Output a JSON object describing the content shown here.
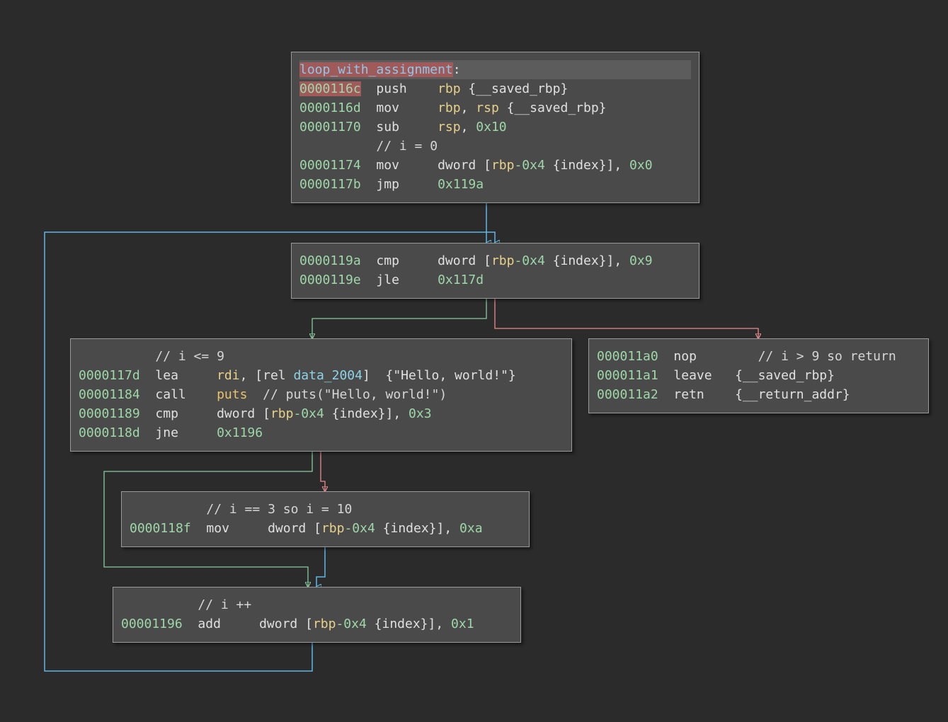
{
  "colors": {
    "background": "#2b2b2b",
    "block_bg": "#4a4a4a",
    "edge_unconditional": "#5fb8e6",
    "edge_true": "#89c9a0",
    "edge_false": "#e88c8c",
    "address": "#9ed7a8",
    "register": "#e8d28a",
    "symbol": "#8fd3e8",
    "function": "#e8c36a"
  },
  "blocks": {
    "entry": {
      "label": "loop_with_assignment",
      "label_suffix": ":",
      "lines": [
        {
          "addr": "0000116c",
          "mnemonic": "push",
          "tokens": [
            {
              "t": "reg",
              "v": "rbp"
            },
            {
              "t": "txt",
              "v": " {__saved_rbp}"
            }
          ]
        },
        {
          "addr": "0000116d",
          "mnemonic": "mov",
          "tokens": [
            {
              "t": "reg",
              "v": "rbp"
            },
            {
              "t": "txt",
              "v": ", "
            },
            {
              "t": "reg",
              "v": "rsp"
            },
            {
              "t": "txt",
              "v": " {__saved_rbp}"
            }
          ]
        },
        {
          "addr": "00001170",
          "mnemonic": "sub",
          "tokens": [
            {
              "t": "reg",
              "v": "rsp"
            },
            {
              "t": "txt",
              "v": ", "
            },
            {
              "t": "num",
              "v": "0x10"
            }
          ]
        },
        {
          "comment": "// i = 0"
        },
        {
          "addr": "00001174",
          "mnemonic": "mov",
          "tokens": [
            {
              "t": "txt",
              "v": "dword ["
            },
            {
              "t": "reg",
              "v": "rbp"
            },
            {
              "t": "num",
              "v": "-0x4"
            },
            {
              "t": "txt",
              "v": " {index}], "
            },
            {
              "t": "num",
              "v": "0x0"
            }
          ]
        },
        {
          "addr": "0000117b",
          "mnemonic": "jmp",
          "tokens": [
            {
              "t": "num",
              "v": "0x119a"
            }
          ]
        }
      ]
    },
    "cond": {
      "lines": [
        {
          "addr": "0000119a",
          "mnemonic": "cmp",
          "tokens": [
            {
              "t": "txt",
              "v": "dword ["
            },
            {
              "t": "reg",
              "v": "rbp"
            },
            {
              "t": "num",
              "v": "-0x4"
            },
            {
              "t": "txt",
              "v": " {index}], "
            },
            {
              "t": "num",
              "v": "0x9"
            }
          ]
        },
        {
          "addr": "0000119e",
          "mnemonic": "jle",
          "tokens": [
            {
              "t": "num",
              "v": "0x117d"
            }
          ]
        }
      ]
    },
    "body": {
      "lines": [
        {
          "comment": "// i <= 9"
        },
        {
          "addr": "0000117d",
          "mnemonic": "lea",
          "tokens": [
            {
              "t": "reg",
              "v": "rdi"
            },
            {
              "t": "txt",
              "v": ", [rel "
            },
            {
              "t": "sym",
              "v": "data_2004"
            },
            {
              "t": "txt",
              "v": "]  {\"Hello, world!\"}"
            }
          ]
        },
        {
          "addr": "00001184",
          "mnemonic": "call",
          "tokens": [
            {
              "t": "fn",
              "v": "puts"
            },
            {
              "t": "cmt",
              "v": "  // puts(\"Hello, world!\")"
            }
          ]
        },
        {
          "addr": "00001189",
          "mnemonic": "cmp",
          "tokens": [
            {
              "t": "txt",
              "v": "dword ["
            },
            {
              "t": "reg",
              "v": "rbp"
            },
            {
              "t": "num",
              "v": "-0x4"
            },
            {
              "t": "txt",
              "v": " {index}], "
            },
            {
              "t": "num",
              "v": "0x3"
            }
          ]
        },
        {
          "addr": "0000118d",
          "mnemonic": "jne",
          "tokens": [
            {
              "t": "num",
              "v": "0x1196"
            }
          ]
        }
      ]
    },
    "exit": {
      "lines": [
        {
          "addr": "000011a0",
          "mnemonic": "nop",
          "tokens": [
            {
              "t": "cmt",
              "v": "   // i > 9 so return"
            }
          ]
        },
        {
          "addr": "000011a1",
          "mnemonic": "leave",
          "tokens": [
            {
              "t": "txt",
              "v": "{__saved_rbp}"
            }
          ]
        },
        {
          "addr": "000011a2",
          "mnemonic": "retn",
          "tokens": [
            {
              "t": "txt",
              "v": "{__return_addr}"
            }
          ]
        }
      ]
    },
    "assign": {
      "lines": [
        {
          "comment": "// i == 3 so i = 10"
        },
        {
          "addr": "0000118f",
          "mnemonic": "mov",
          "tokens": [
            {
              "t": "txt",
              "v": "dword ["
            },
            {
              "t": "reg",
              "v": "rbp"
            },
            {
              "t": "num",
              "v": "-0x4"
            },
            {
              "t": "txt",
              "v": " {index}], "
            },
            {
              "t": "num",
              "v": "0xa"
            }
          ]
        }
      ]
    },
    "incr": {
      "lines": [
        {
          "comment": "// i ++"
        },
        {
          "addr": "00001196",
          "mnemonic": "add",
          "tokens": [
            {
              "t": "txt",
              "v": "dword ["
            },
            {
              "t": "reg",
              "v": "rbp"
            },
            {
              "t": "num",
              "v": "-0x4"
            },
            {
              "t": "txt",
              "v": " {index}], "
            },
            {
              "t": "num",
              "v": "0x1"
            }
          ]
        }
      ]
    }
  }
}
